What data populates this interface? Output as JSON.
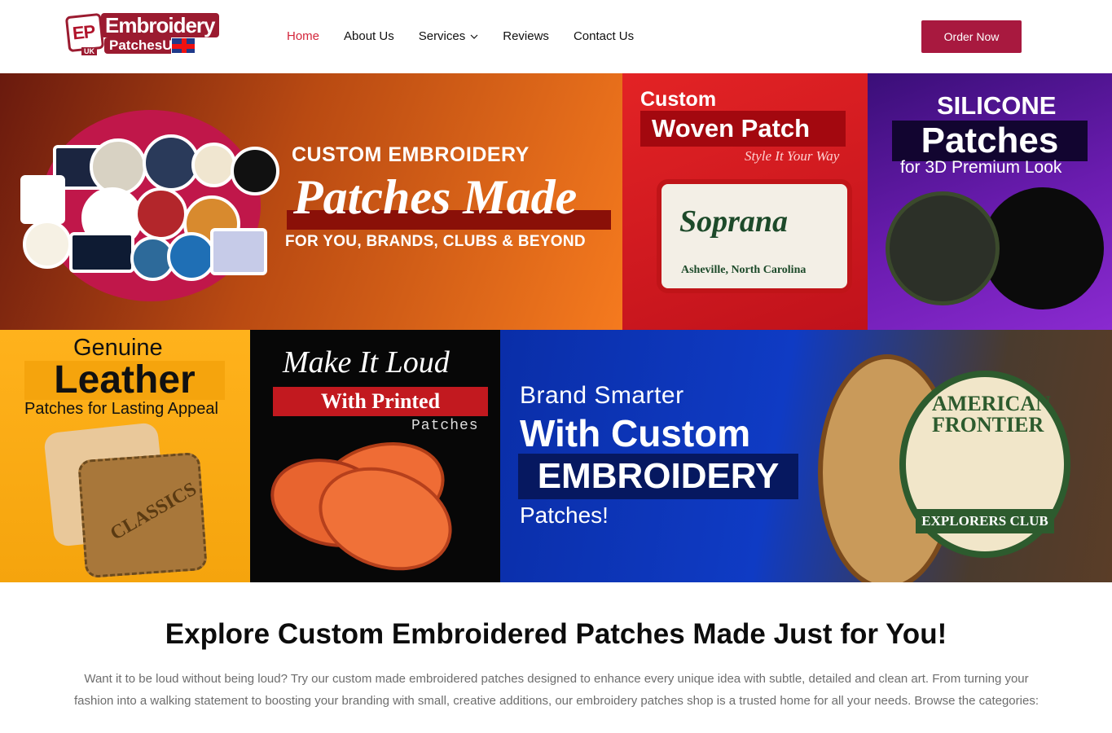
{
  "header": {
    "logo": {
      "prefix": "EP",
      "line1": "Embroidery",
      "line2": "PatchesUK",
      "badge": "UK"
    },
    "nav": [
      {
        "label": "Home",
        "active": true
      },
      {
        "label": "About Us"
      },
      {
        "label": "Services",
        "has_dropdown": true
      },
      {
        "label": "Reviews"
      },
      {
        "label": "Contact Us"
      }
    ],
    "order_button": "Order Now",
    "accent": "#a8193f"
  },
  "banners": {
    "embroidery": {
      "line1": "CUSTOM EMBROIDERY",
      "line2": "Patches Made",
      "line3": "FOR YOU, BRANDS, CLUBS & BEYOND"
    },
    "woven": {
      "line1": "Custom",
      "line2": "Woven Patch",
      "tagline": "Style It Your Way",
      "patch_title": "Soprana",
      "patch_sub": "Asheville, North Carolina"
    },
    "silicone": {
      "line1": "SILICONE",
      "line2": "Patches",
      "line3": "for 3D Premium Look"
    },
    "leather": {
      "line1": "Genuine",
      "line2": "Leather",
      "line3": "Patches for Lasting Appeal",
      "patch_text": "CLASSICS"
    },
    "printed": {
      "line1": "Make It Loud",
      "line2": "With Printed",
      "line3": "Patches"
    },
    "custom": {
      "line1": "Brand Smarter",
      "line2": "With Custom",
      "line3": "EMBROIDERY",
      "line4": "Patches!",
      "patch_title": "AMERICAN FRONTIER",
      "patch_ribbon": "EXPLORERS CLUB"
    }
  },
  "intro": {
    "heading": "Explore Custom Embroidered Patches Made Just for You!",
    "body": "Want it to be loud without being loud? Try our custom made embroidered patches designed to enhance every unique idea with subtle, detailed and clean art. From turning your fashion into a walking statement to boosting your branding with small, creative additions, our embroidery patches shop is a trusted home for all your needs. Browse the categories:"
  }
}
